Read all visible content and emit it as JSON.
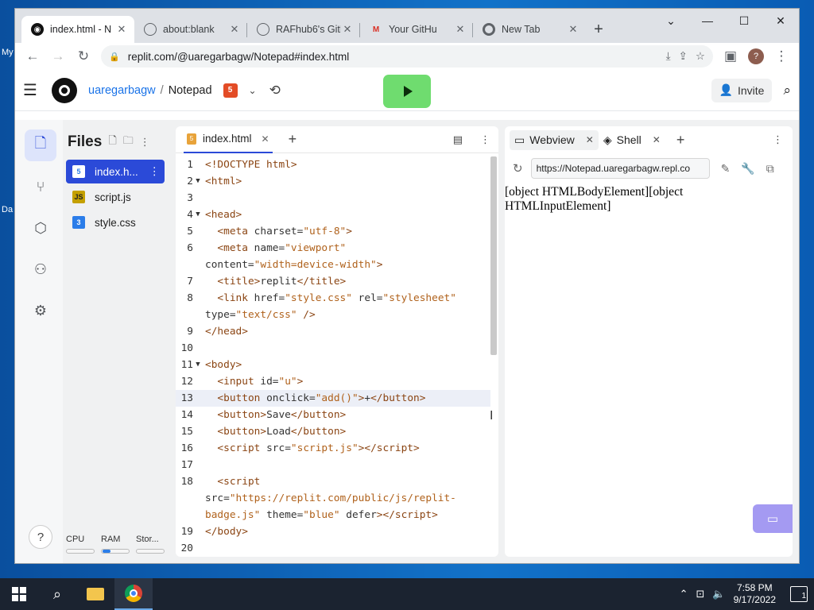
{
  "desktop": {
    "labels": [
      "My",
      "Da"
    ]
  },
  "browser": {
    "tabs": [
      {
        "title": "index.html - N",
        "icon": "replit-icon",
        "active": true
      },
      {
        "title": "about:blank",
        "icon": "globe-icon"
      },
      {
        "title": "RAFhub6's GitH",
        "icon": "globe-icon"
      },
      {
        "title": "Your GitHu",
        "icon": "gmail-icon"
      },
      {
        "title": "New Tab",
        "icon": "chrome-icon"
      }
    ],
    "new_tab_label": "+",
    "url": "replit.com/@uaregarbagw/Notepad#index.html",
    "profile_initial": "?"
  },
  "replit": {
    "username": "uaregarbagw",
    "separator": "/",
    "repl_name": "Notepad",
    "lang_badge": "5",
    "invite_label": "Invite",
    "files_title": "Files",
    "files": [
      {
        "name": "index.h...",
        "icon": "html-file-icon",
        "active": true,
        "icon_text": "5",
        "icon_color": "#2b7de9"
      },
      {
        "name": "script.js",
        "icon": "js-file-icon",
        "icon_text": "JS",
        "icon_color": "#c4a000"
      },
      {
        "name": "style.css",
        "icon": "css-file-icon",
        "icon_text": "3",
        "icon_color": "#2b7de9"
      }
    ],
    "meters": [
      {
        "label": "CPU",
        "fill": 0.0
      },
      {
        "label": "RAM",
        "fill": 0.3
      },
      {
        "label": "Stor...",
        "fill": 0.0
      }
    ],
    "editor_tab": "index.html",
    "code": [
      {
        "n": "1",
        "fold": "",
        "html": "<span class='tag'>&lt;!DOCTYPE html&gt;</span>"
      },
      {
        "n": "2",
        "fold": "▼",
        "html": "<span class='tag'>&lt;html&gt;</span>"
      },
      {
        "n": "3",
        "fold": "",
        "html": ""
      },
      {
        "n": "4",
        "fold": "▼",
        "html": "<span class='tag'>&lt;head&gt;</span>"
      },
      {
        "n": "5",
        "fold": "",
        "html": "  <span class='tag'>&lt;meta</span> <span class='attr'>charset=</span><span class='str'>\"utf-8\"</span><span class='tag'>&gt;</span>"
      },
      {
        "n": "6",
        "fold": "",
        "html": "  <span class='tag'>&lt;meta</span> <span class='attr'>name=</span><span class='str'>\"viewport\"</span>"
      },
      {
        "n": "",
        "fold": "",
        "html": "<span class='attr'>content=</span><span class='str'>\"width=device-width\"</span><span class='tag'>&gt;</span>"
      },
      {
        "n": "7",
        "fold": "",
        "html": "  <span class='tag'>&lt;title&gt;</span><span class='txt'>replit</span><span class='tag'>&lt;/title&gt;</span>"
      },
      {
        "n": "8",
        "fold": "",
        "html": "  <span class='tag'>&lt;link</span> <span class='attr'>href=</span><span class='str'>\"style.css\"</span> <span class='attr'>rel=</span><span class='str'>\"stylesheet\"</span>"
      },
      {
        "n": "",
        "fold": "",
        "html": "<span class='attr'>type=</span><span class='str'>\"text/css\"</span> <span class='tag'>/&gt;</span>"
      },
      {
        "n": "9",
        "fold": "",
        "html": "<span class='tag'>&lt;/head&gt;</span>"
      },
      {
        "n": "10",
        "fold": "",
        "html": ""
      },
      {
        "n": "11",
        "fold": "▼",
        "html": "<span class='tag'>&lt;body&gt;</span>"
      },
      {
        "n": "12",
        "fold": "",
        "html": "  <span class='tag'>&lt;input</span> <span class='attr'>id=</span><span class='str'>\"u\"</span><span class='tag'>&gt;</span>"
      },
      {
        "n": "13",
        "fold": "",
        "html": "  <span class='tag'>&lt;button</span> <span class='attr'>onclick=</span><span class='str'>\"add()\"</span><span class='tag'>&gt;</span><span class='txt'>+</span><span class='tag'>&lt;/button&gt;</span>",
        "highlight": true
      },
      {
        "n": "14",
        "fold": "",
        "html": "  <span class='tag'>&lt;button&gt;</span><span class='txt'>Save</span><span class='tag'>&lt;/button&gt;</span>"
      },
      {
        "n": "15",
        "fold": "",
        "html": "  <span class='tag'>&lt;button&gt;</span><span class='txt'>Load</span><span class='tag'>&lt;/button&gt;</span>"
      },
      {
        "n": "16",
        "fold": "",
        "html": "  <span class='tag'>&lt;script</span> <span class='attr'>src=</span><span class='str'>\"script.js\"</span><span class='tag'>&gt;&lt;/script&gt;</span>"
      },
      {
        "n": "17",
        "fold": "",
        "html": ""
      },
      {
        "n": "18",
        "fold": "",
        "html": "  <span class='tag'>&lt;script</span>"
      },
      {
        "n": "",
        "fold": "",
        "html": "<span class='attr'>src=</span><span class='str'>\"https://replit.com/public/js/replit-</span>"
      },
      {
        "n": "",
        "fold": "",
        "html": "<span class='str'>badge.js\"</span> <span class='attr'>theme=</span><span class='str'>\"blue\"</span> <span class='attr'>defer</span><span class='tag'>&gt;&lt;/script&gt;</span>"
      },
      {
        "n": "19",
        "fold": "",
        "html": "<span class='tag'>&lt;/body&gt;</span>"
      },
      {
        "n": "20",
        "fold": "",
        "html": ""
      }
    ],
    "preview_tabs": [
      {
        "label": "Webview",
        "icon": "monitor-icon",
        "active": true
      },
      {
        "label": "Shell",
        "icon": "shell-icon"
      }
    ],
    "preview_url": "https://Notepad.uaregarbagw.repl.co",
    "preview_output": "[object HTMLBodyElement][object HTMLInputElement]"
  },
  "taskbar": {
    "time": "7:58 PM",
    "date": "9/17/2022",
    "notifications": "1"
  }
}
